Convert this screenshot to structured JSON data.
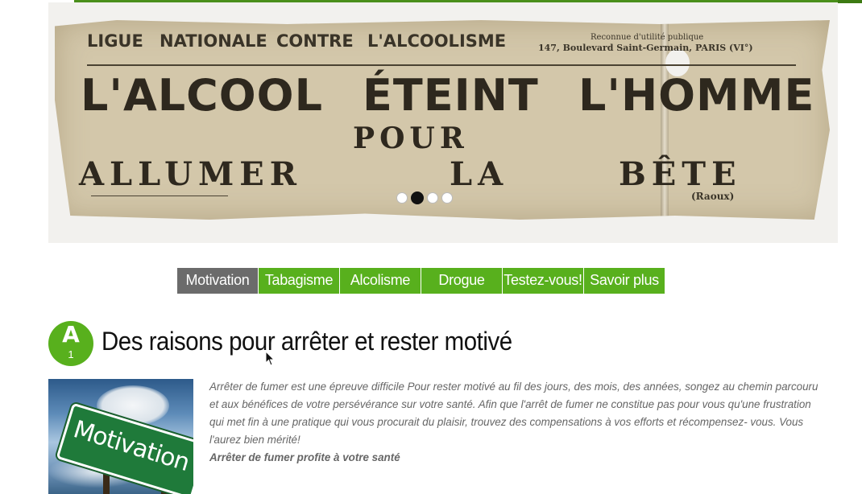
{
  "banner": {
    "poster": {
      "header_left": [
        "LIGUE",
        "NATIONALE",
        "CONTRE",
        "L'ALCOOLISME"
      ],
      "header_right_1": "Reconnue d'utilité publique",
      "header_right_2": "147, Boulevard Saint-Germain, PARIS (VI°)",
      "big_line_words": [
        "L'ALCOOL",
        "ÉTEINT",
        "L'HOMME"
      ],
      "pour": "POUR",
      "bottom_line_words": [
        "ALLUMER",
        "LA",
        "BÊTE"
      ],
      "signature": "(Raoux)"
    },
    "slider": {
      "count": 4,
      "active_index": 1
    }
  },
  "tabs": [
    {
      "label": "Motivation",
      "active": true
    },
    {
      "label": "Tabagisme",
      "active": false
    },
    {
      "label": "Alcolisme",
      "active": false
    },
    {
      "label": "Drogue",
      "active": false
    },
    {
      "label": "Testez-vous!",
      "active": false
    },
    {
      "label": "Savoir plus",
      "active": false
    }
  ],
  "section": {
    "badge_letter": "A",
    "badge_number": "1",
    "title": "Des raisons pour arrêter et rester motivé",
    "thumbnail_sign": "Motivation",
    "paragraph": "Arrêter de fumer est une épreuve difficile Pour rester motivé au fil des jours, des mois, des années, songez au chemin parcouru et aux bénéfices de votre persévérance sur votre santé. Afin que l'arrêt de fumer ne constitue pas pour vous qu'une frustration qui met fin à une pratique qui vous procurait du plaisir, trouvez des compensations à vos efforts et récompensez- vous. Vous l'aurez bien mérité!",
    "subheading": "Arrêter de fumer profite à votre santé"
  },
  "colors": {
    "accent_green": "#58b01d",
    "active_tab": "#6b6b6b",
    "body_text": "#666666"
  }
}
